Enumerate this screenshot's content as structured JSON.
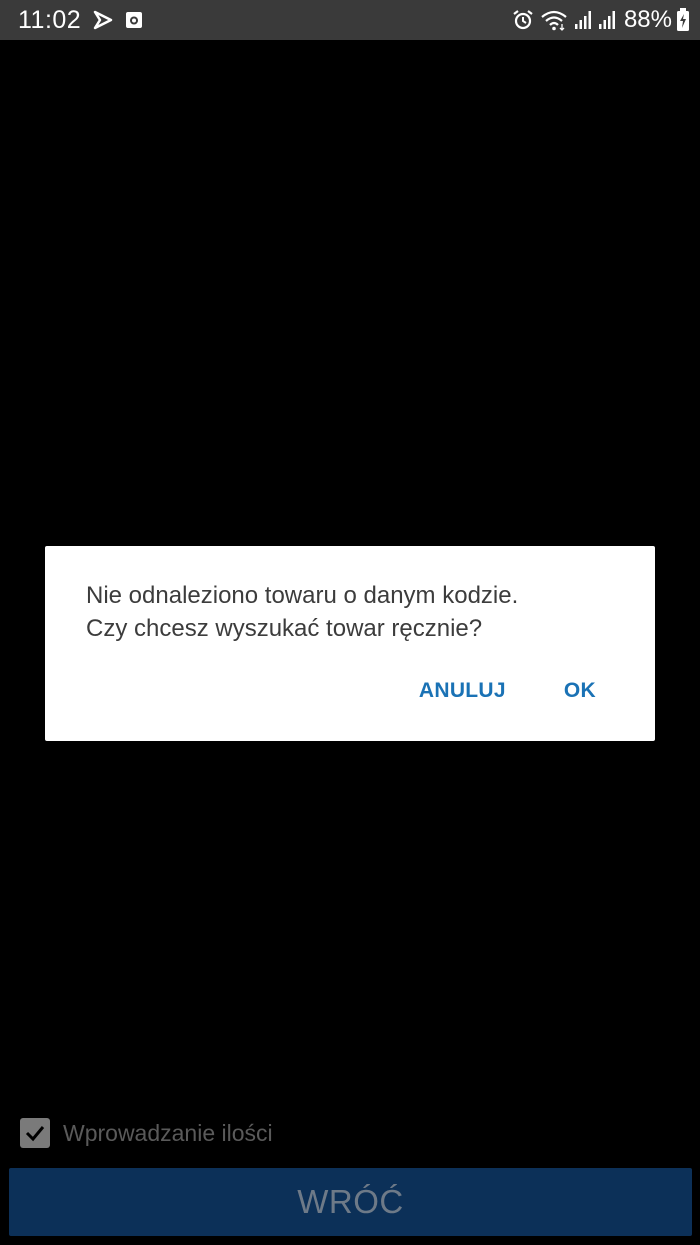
{
  "status_bar": {
    "time": "11:02",
    "battery_percent": "88%",
    "left_icons": [
      "navigation-icon",
      "camera-app-icon"
    ],
    "right_icons": [
      "alarm-icon",
      "wifi-icon",
      "signal-icon",
      "signal-icon",
      "battery-charging-icon"
    ]
  },
  "dialog": {
    "message_line1": "Nie odnaleziono towaru o danym kodzie.",
    "message_line2": "Czy chcesz wyszukać towar ręcznie?",
    "cancel_label": "ANULUJ",
    "ok_label": "OK"
  },
  "app": {
    "quantity_checkbox_label": "Wprowadzanie ilości",
    "quantity_checkbox_checked": true,
    "back_button_label": "WRÓĆ"
  },
  "colors": {
    "accent": "#1a72b5",
    "button_bg": "#0c3058",
    "status_bar_bg": "#3a3a3a"
  }
}
